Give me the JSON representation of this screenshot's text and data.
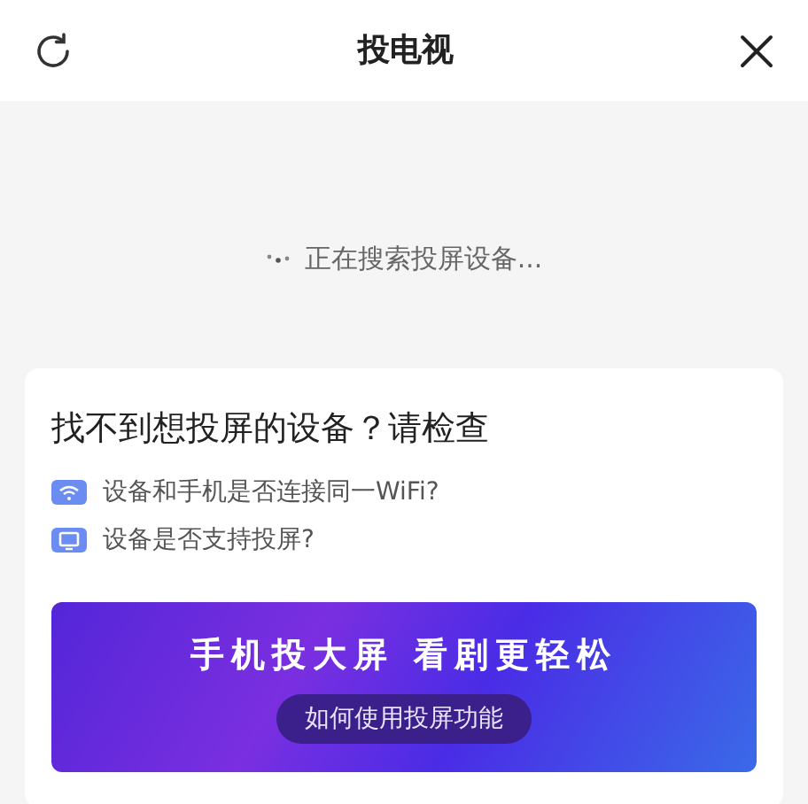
{
  "header": {
    "title": "投电视"
  },
  "status": {
    "text": "正在搜索投屏设备..."
  },
  "help_card": {
    "title": "找不到想投屏的设备？请检查",
    "items": [
      {
        "kind": "wifi",
        "text": "设备和手机是否连接同一WiFi?"
      },
      {
        "kind": "tv",
        "text": "设备是否支持投屏?"
      }
    ],
    "banner": {
      "headline": "手机投大屏 看剧更轻松",
      "button": "如何使用投屏功能"
    }
  }
}
